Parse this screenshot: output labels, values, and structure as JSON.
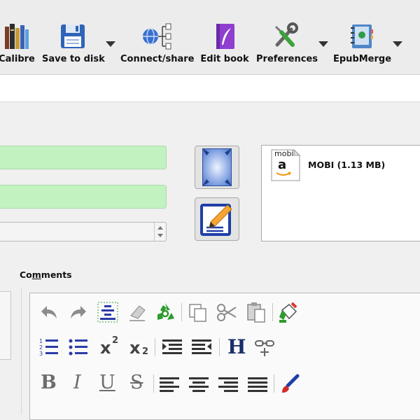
{
  "toolbar": {
    "buttons": [
      {
        "label": "Calibre",
        "icon": "books-icon"
      },
      {
        "label": "Save to disk",
        "icon": "floppy-disk-icon"
      },
      {
        "label": "Connect/share",
        "icon": "network-icon"
      },
      {
        "label": "Edit book",
        "icon": "book-quill-icon"
      },
      {
        "label": "Preferences",
        "icon": "tools-icon"
      },
      {
        "label": "EpubMerge",
        "icon": "notebook-icon"
      }
    ]
  },
  "formats": {
    "items": [
      {
        "badge": "mobi",
        "logo": "a",
        "text": "MOBI (1.13 MB)"
      }
    ]
  },
  "comments": {
    "label": "Comments",
    "mnemonic": "m"
  },
  "editor": {
    "row2": {
      "superscript": "x",
      "superscript_exp": "2",
      "subscript": "x",
      "subscript_exp": "2",
      "heading": "H"
    },
    "row3": {
      "bold": "B",
      "italic": "I",
      "underline": "U",
      "strike": "S"
    }
  },
  "colors": {
    "field_green": "#c3f2c1",
    "accent_blue": "#1f3fa8",
    "recycle_green": "#2e9b2e"
  }
}
